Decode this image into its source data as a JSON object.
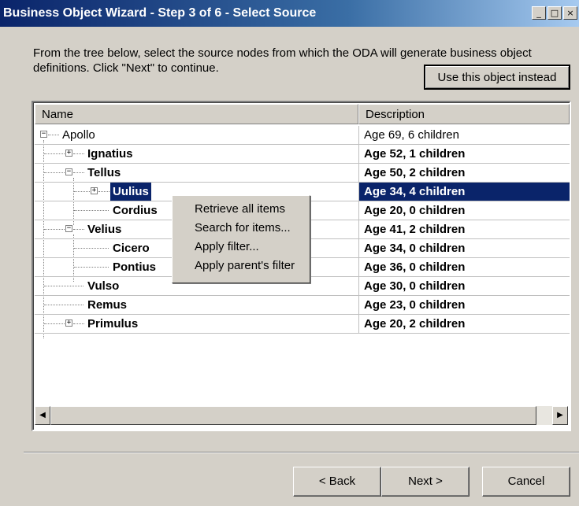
{
  "window": {
    "title": "Business Object Wizard - Step 3 of 6 - Select Source"
  },
  "instructions": "From the tree below, select the source nodes from which the ODA will generate business object definitions. Click \"Next\" to continue.",
  "use_object_button": "Use this object instead",
  "columns": {
    "name": "Name",
    "description": "Description"
  },
  "tree": [
    {
      "name": "Apollo",
      "description": "Age 69, 6 children"
    },
    {
      "name": "Ignatius",
      "description": "Age 52, 1 children"
    },
    {
      "name": "Tellus",
      "description": "Age 50, 2 children"
    },
    {
      "name": "Uulius",
      "description": "Age 34, 4 children"
    },
    {
      "name": "Cordius",
      "description": "Age 20, 0 children"
    },
    {
      "name": "Velius",
      "description": "Age 41, 2 children"
    },
    {
      "name": "Cicero",
      "description": "Age 34, 0 children"
    },
    {
      "name": "Pontius",
      "description": "Age 36, 0 children"
    },
    {
      "name": "Vulso",
      "description": "Age 30, 0 children"
    },
    {
      "name": "Remus",
      "description": "Age 23, 0 children"
    },
    {
      "name": "Primulus",
      "description": "Age 20, 2 children"
    }
  ],
  "context_menu": [
    "Retrieve all items",
    "Search for items...",
    "Apply filter...",
    "Apply parent's filter"
  ],
  "buttons": {
    "back": "< Back",
    "next": "Next >",
    "cancel": "Cancel"
  },
  "colors": {
    "selection": "#0a246a",
    "dialog": "#d4d0c8"
  }
}
